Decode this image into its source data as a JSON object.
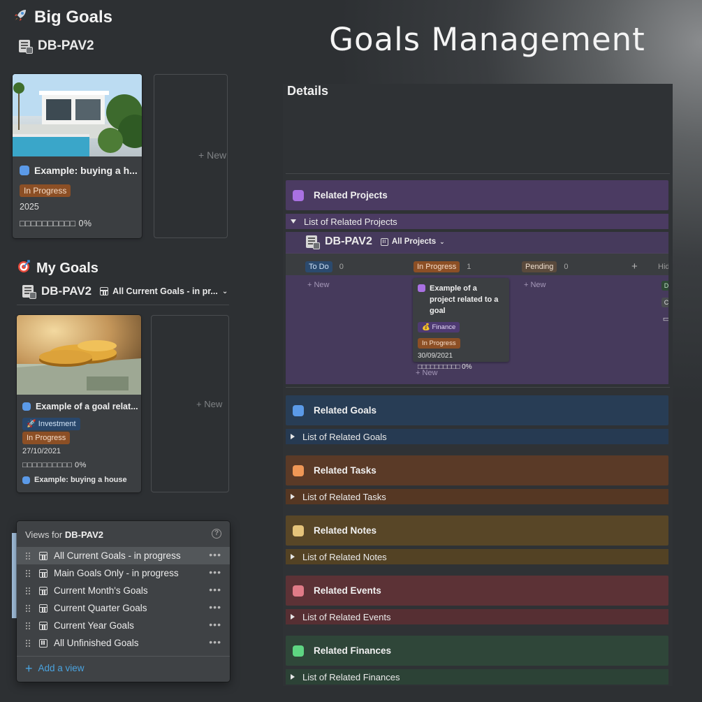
{
  "headline": "Goals Management",
  "big_goals": {
    "title": "Big Goals",
    "db_name": "DB-PAV2",
    "card": {
      "title": "Example: buying a h...",
      "status": "In Progress",
      "year": "2025",
      "progress": "□□□□□□□□□□ 0%"
    },
    "new_label": "New"
  },
  "my_goals": {
    "title": "My Goals",
    "db_name": "DB-PAV2",
    "view_name": "All Current Goals - in pr...",
    "card": {
      "title": "Example of a goal relat...",
      "category": "Investment",
      "status": "In Progress",
      "date": "27/10/2021",
      "progress": "□□□□□□□□□□ 0%",
      "related": "Example: buying a house"
    },
    "new_label": "New"
  },
  "views_popup": {
    "prefix": "Views for",
    "db_name": "DB-PAV2",
    "help": "?",
    "views": [
      {
        "label": "All Current Goals - in progress",
        "icon": "table-icon",
        "active": true
      },
      {
        "label": "Main Goals Only - in progress",
        "icon": "table-icon",
        "active": false
      },
      {
        "label": "Current Month's Goals",
        "icon": "table-icon",
        "active": false
      },
      {
        "label": "Current Quarter Goals",
        "icon": "table-icon",
        "active": false
      },
      {
        "label": "Current Year Goals",
        "icon": "table-icon",
        "active": false
      },
      {
        "label": "All Unfinished Goals",
        "icon": "board-icon",
        "active": false
      }
    ],
    "more": "•••",
    "add_view": "Add a view"
  },
  "details": {
    "title": "Details",
    "sections": [
      {
        "label": "Related Projects",
        "toggle": "List of Related Projects",
        "color": "#4b3b62",
        "toggle_color": "#4b3b62",
        "icon_color": "#a971e2",
        "expanded": true
      },
      {
        "label": "Related Goals",
        "toggle": "List of Related Goals",
        "color": "#283d55",
        "toggle_color": "#263a52",
        "icon_color": "#5b9ae8",
        "expanded": false
      },
      {
        "label": "Related Tasks",
        "toggle": "List of Related Tasks",
        "color": "#5a3a27",
        "toggle_color": "#553723",
        "icon_color": "#ef9756",
        "expanded": false
      },
      {
        "label": "Related Notes",
        "toggle": "List of Related Notes",
        "color": "#584627",
        "toggle_color": "#534224",
        "icon_color": "#e5c37a",
        "expanded": false
      },
      {
        "label": "Related Events",
        "toggle": "List of Related Events",
        "color": "#5c3236",
        "toggle_color": "#562f33",
        "icon_color": "#e07b87",
        "expanded": false
      },
      {
        "label": "Related Finances",
        "toggle": "List of Related Finances",
        "color": "#2f4639",
        "toggle_color": "#2c4236",
        "icon_color": "#5ed582",
        "expanded": false
      }
    ],
    "board": {
      "db_name": "DB-PAV2",
      "view_name": "All Projects",
      "columns": [
        {
          "label": "To Do",
          "count": "0",
          "color": "#2b4a6e",
          "text": "#cfe2f7"
        },
        {
          "label": "In Progress",
          "count": "1",
          "color": "#8c4f25",
          "text": "#f6ddc8"
        },
        {
          "label": "Pending",
          "count": "0",
          "color": "#5a4a3c",
          "text": "#f0e0d0"
        }
      ],
      "new_label": "New",
      "add": "+",
      "hidden_label": "Hid",
      "card": {
        "title": "Example of a project related to a goal",
        "category": "Finance",
        "status": "In Progress",
        "date": "30/09/2021",
        "progress": "□□□□□□□□□□ 0%"
      }
    }
  }
}
